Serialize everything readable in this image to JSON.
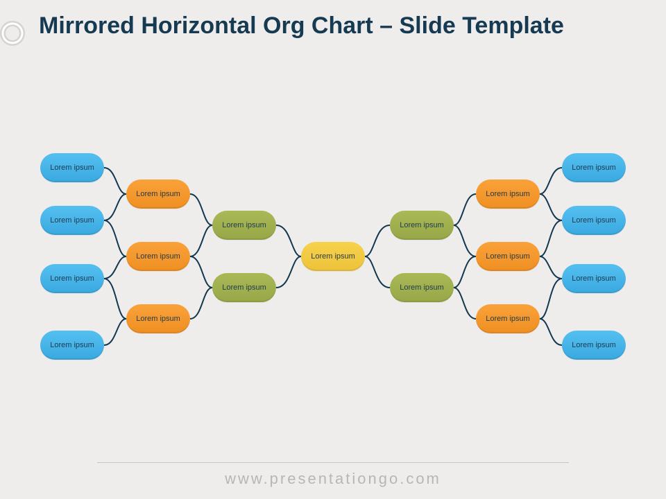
{
  "title": "Mirrored Horizontal Org Chart – Slide Template",
  "footer": "www.presentationgo.com",
  "center": "Lorem ipsum",
  "left": {
    "level2": [
      "Lorem ipsum",
      "Lorem ipsum"
    ],
    "level3": [
      "Lorem ipsum",
      "Lorem ipsum",
      "Lorem ipsum"
    ],
    "level4": [
      "Lorem ipsum",
      "Lorem ipsum",
      "Lorem ipsum",
      "Lorem ipsum"
    ]
  },
  "right": {
    "level2": [
      "Lorem ipsum",
      "Lorem ipsum"
    ],
    "level3": [
      "Lorem ipsum",
      "Lorem ipsum",
      "Lorem ipsum"
    ],
    "level4": [
      "Lorem ipsum",
      "Lorem ipsum",
      "Lorem ipsum",
      "Lorem ipsum"
    ]
  },
  "colors": {
    "blue": "#3aa9e0",
    "orange": "#ef8f22",
    "green": "#97a748",
    "yellow": "#eec23b",
    "connector": "#12384f"
  }
}
